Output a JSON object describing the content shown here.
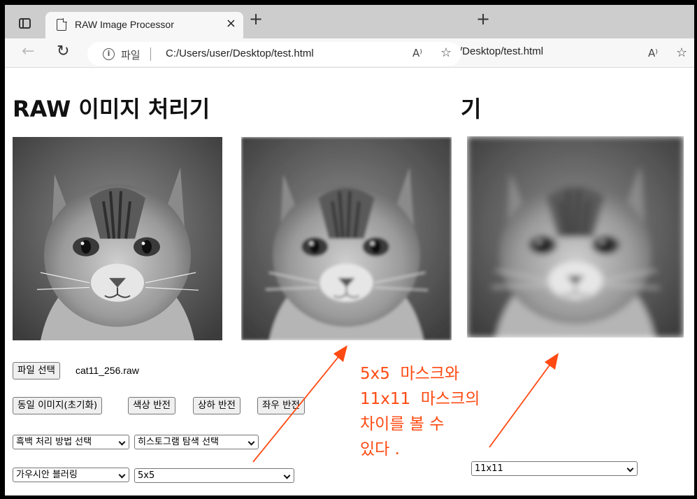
{
  "browser": {
    "tab_title": "RAW Image Processor",
    "tab_close": "×",
    "new_tab": "+",
    "back_glyph": "←",
    "reload_glyph": "↻",
    "scheme_label": "파일",
    "url": "C:/Users/user/Desktop/test.html",
    "read_aloud": "A⁾",
    "favorites": "☆",
    "second_window_url": "/Desktop/test.html"
  },
  "page": {
    "title": "RAW 이미지 처리기",
    "second_title_fragment": "기"
  },
  "images": [
    {
      "name": "original",
      "blur": 0
    },
    {
      "name": "blur-5x5",
      "blur": 2.2
    },
    {
      "name": "blur-11x11",
      "blur": 4.6
    }
  ],
  "controls": {
    "file_button": "파일 선택",
    "file_name": "cat11_256.raw",
    "reset_button": "동일 이미지(초기화)",
    "invert_button": "색상 반전",
    "flip_v_button": "상하 반전",
    "flip_h_button": "좌우 반전",
    "bw_select": "흑백 처리 방법 선택",
    "histogram_select": "히스토그램 탐색 선택",
    "filter_select": "가우시안 블러링",
    "mask_select": "5x5",
    "mask_select_2": "11x11"
  },
  "annotation": {
    "text": "5x5  마스크와\n11x11  마스크의\n차이를 볼 수\n있다 .",
    "color": "#ff4a12"
  },
  "icons": [
    "sidebar-icon",
    "page-icon",
    "info-icon",
    "read-aloud-icon",
    "favorites-icon"
  ]
}
